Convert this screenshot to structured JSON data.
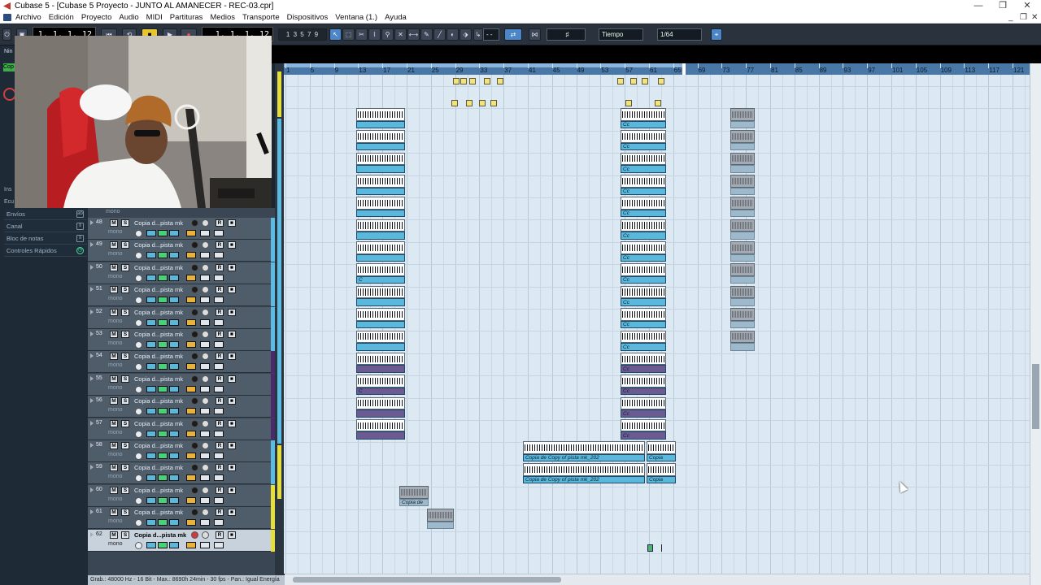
{
  "window": {
    "title": "Cubase 5 - [Cubase 5 Proyecto - JUNTO AL AMANECER - REC-03.cpr]",
    "controls": [
      "—",
      "❐",
      "✕"
    ]
  },
  "menu": [
    "Archivo",
    "Edición",
    "Proyecto",
    "Audio",
    "MIDI",
    "Partituras",
    "Medios",
    "Transporte",
    "Dispositivos",
    "Ventana (1.)",
    "Ayuda"
  ],
  "toolbar": {
    "left_locator": "1. 1. 1. 12",
    "position": "1. 1. 1. 12",
    "grid_label": "Tiempo",
    "quantize": "1/64",
    "snap_value": "- -"
  },
  "inspector": {
    "sections": [
      "Envíos",
      "Canal",
      "Bloc de notas",
      "Controles Rápidos"
    ],
    "partial_labels": [
      "Nin",
      "Cop",
      "Ins",
      "Ecu"
    ]
  },
  "tracks": [
    {
      "num": "48",
      "name": "Copia d...pista mk",
      "type": "mono"
    },
    {
      "num": "49",
      "name": "Copia d...pista mk",
      "type": "mono"
    },
    {
      "num": "50",
      "name": "Copia d...pista mk",
      "type": "mono"
    },
    {
      "num": "51",
      "name": "Copia d...pista mk",
      "type": "mono"
    },
    {
      "num": "52",
      "name": "Copia d...pista mk",
      "type": "mono"
    },
    {
      "num": "53",
      "name": "Copia d...pista mk",
      "type": "mono"
    },
    {
      "num": "54",
      "name": "Copia d...pista mk",
      "type": "mono"
    },
    {
      "num": "55",
      "name": "Copia d...pista mk",
      "type": "mono"
    },
    {
      "num": "56",
      "name": "Copia d...pista mk",
      "type": "mono"
    },
    {
      "num": "57",
      "name": "Copia d...pista mk",
      "type": "mono"
    },
    {
      "num": "58",
      "name": "Copia d...pista mk",
      "type": "mono"
    },
    {
      "num": "59",
      "name": "Copia d...pista mk",
      "type": "mono"
    },
    {
      "num": "60",
      "name": "Copia d...pista mk",
      "type": "mono"
    },
    {
      "num": "61",
      "name": "Copia d...pista mk",
      "type": "mono"
    },
    {
      "num": "62",
      "name": "Copia d...pista mk",
      "type": "mono"
    }
  ],
  "top_track_partial_type": "mono",
  "ruler_labels": [
    "1",
    "5",
    "9",
    "13",
    "17",
    "21",
    "25",
    "29",
    "33",
    "37",
    "41",
    "45",
    "49",
    "53",
    "57",
    "61",
    "65",
    "69",
    "73",
    "77",
    "81",
    "85",
    "89",
    "93",
    "97",
    "101",
    "105",
    "109",
    "113",
    "117",
    "121"
  ],
  "event_captions": {
    "c": "C",
    "cc": "Cc",
    "clip58": "Copia de Copy of pista mk_202",
    "clip58b": "Copia",
    "clip60": "Copia de"
  },
  "status": "Grab.: 48000 Hz - 16 Bit - Max.: 8690h 24min - 30 fps - Pan.: Igual Energía",
  "colors": {
    "accent": "#4a86c8",
    "arrange_bg": "#dde9f2",
    "event_blue": "#5ab8dc",
    "event_purple": "#6c5a92",
    "midi_yellow": "#f4e27a"
  }
}
